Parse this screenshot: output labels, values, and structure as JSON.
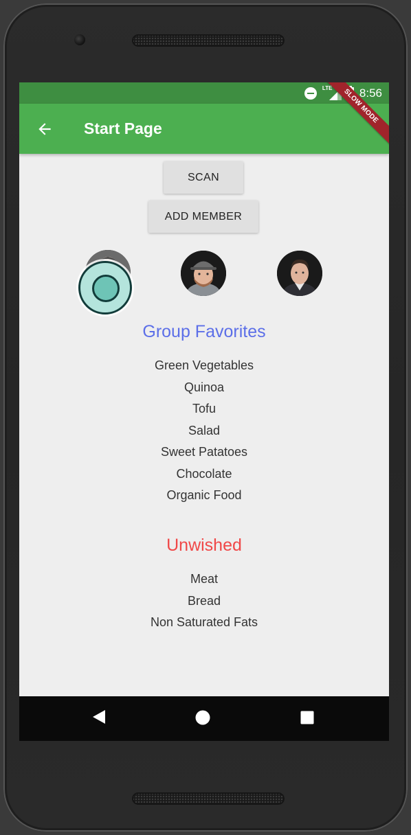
{
  "status_bar": {
    "network": "LTE",
    "time": "8:56",
    "debug_banner": "SLOW MODE"
  },
  "app_bar": {
    "title": "Start Page",
    "back_icon": "arrow-left-icon"
  },
  "buttons": {
    "scan": "SCAN",
    "add_member": "ADD MEMBER"
  },
  "members": [
    {
      "avatar": "member-1",
      "selected": true
    },
    {
      "avatar": "member-2",
      "selected": false
    },
    {
      "avatar": "member-3",
      "selected": false
    }
  ],
  "favorites": {
    "title": "Group Favorites",
    "color": "#5c6fe8",
    "items": [
      "Green Vegetables",
      "Quinoa",
      "Tofu",
      "Salad",
      "Sweet Patatoes",
      "Chocolate",
      "Organic Food"
    ]
  },
  "unwished": {
    "title": "Unwished",
    "color": "#f04848",
    "items": [
      "Meat",
      "Bread",
      "Non Saturated Fats"
    ]
  },
  "nav_bar": {
    "back_icon": "triangle-back-icon",
    "home_icon": "circle-home-icon",
    "recents_icon": "square-recents-icon"
  },
  "colors": {
    "app_bar": "#4caf50",
    "status_bar": "#3e8e41",
    "background": "#eeeeee"
  }
}
